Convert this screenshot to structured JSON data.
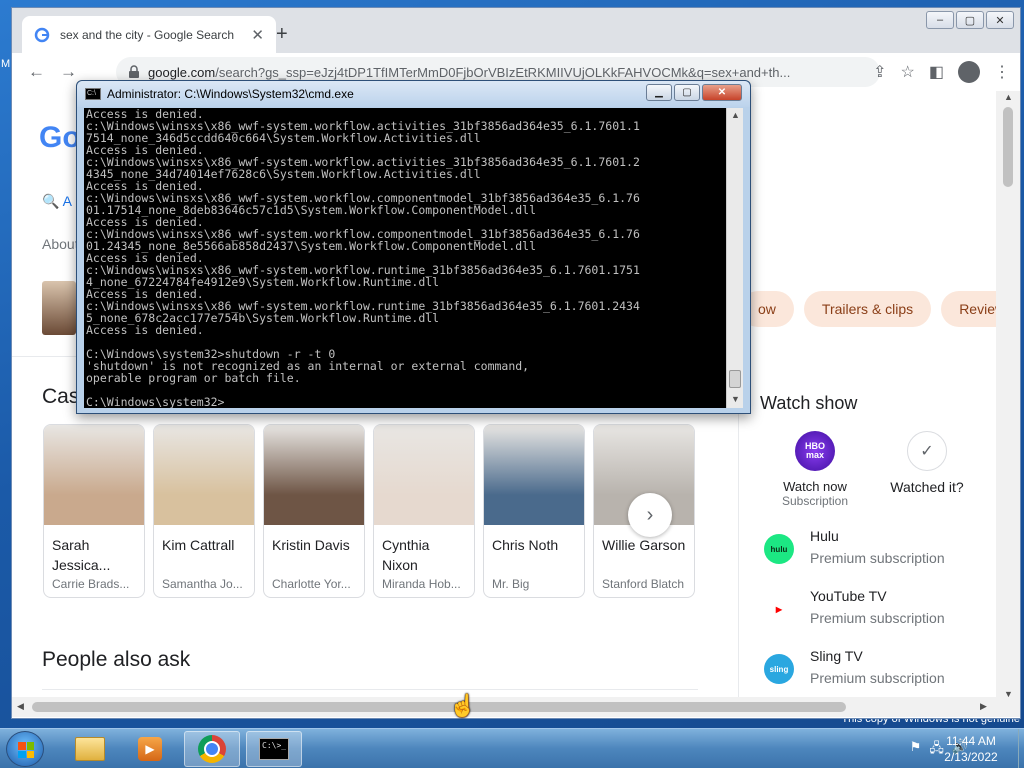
{
  "desktop": {
    "genuine_text": "This copy of Windows is not genuine",
    "side_fragments": [
      "M",
      "7",
      "1"
    ]
  },
  "browser": {
    "tab_title": "sex and the city - Google Search",
    "url_host": "google.com",
    "url_rest": "/search?gs_ssp=eJzj4tDP1TfIMTerMmD0FjbOrVBIzEtRKMIIVUjOLKkFAHVOCMk&q=sex+and+th...",
    "new_tab_glyph": "+",
    "window_controls": [
      "–",
      "▢",
      "✕"
    ]
  },
  "page": {
    "logo_fragment": "Go",
    "tab_fragment": "A",
    "about_fragment": "About",
    "chips": [
      "ow",
      "Trailers & clips",
      "Review"
    ],
    "cast_title_fragment": "Cas",
    "cast": [
      {
        "name": "Sarah Jessica...",
        "role": "Carrie Brads...",
        "color": "#c9a98d"
      },
      {
        "name": "Kim Cattrall",
        "role": "Samantha Jo...",
        "color": "#d8c19e"
      },
      {
        "name": "Kristin Davis",
        "role": "Charlotte Yor...",
        "color": "#6e5545"
      },
      {
        "name": "Cynthia Nixon",
        "role": "Miranda Hob...",
        "color": "#e6d9cf"
      },
      {
        "name": "Chris Noth",
        "role": "Mr. Big",
        "color": "#4a6a8c"
      },
      {
        "name": "Willie Garson",
        "role": "Stanford Blatch",
        "color": "#b8b3ad"
      }
    ],
    "people_also_ask": "People also ask",
    "watch_show": {
      "title": "Watch show",
      "hbo_logo": "HBO max",
      "watch_now": "Watch now",
      "watch_now_sub": "Subscription",
      "watched_it": "Watched it?",
      "providers": [
        {
          "name": "Hulu",
          "sub": "Premium subscription",
          "logo": "hulu",
          "color": "#1ce783",
          "text_color": "#0b2b17"
        },
        {
          "name": "YouTube TV",
          "sub": "Premium subscription",
          "logo": "▶",
          "color": "#ffffff",
          "text_color": "#ff0000"
        },
        {
          "name": "Sling TV",
          "sub": "Premium subscription",
          "logo": "sling",
          "color": "#2aa7e0",
          "text_color": "#ffffff"
        }
      ]
    }
  },
  "cmd": {
    "title": "Administrator: C:\\Windows\\System32\\cmd.exe",
    "icon_text": "C:\\",
    "lines": [
      "Access is denied.",
      "c:\\Windows\\winsxs\\x86_wwf-system.workflow.activities_31bf3856ad364e35_6.1.7601.1",
      "7514_none_346d5ccdd640c664\\System.Workflow.Activities.dll",
      "Access is denied.",
      "c:\\Windows\\winsxs\\x86_wwf-system.workflow.activities_31bf3856ad364e35_6.1.7601.2",
      "4345_none_34d74014ef7628c6\\System.Workflow.Activities.dll",
      "Access is denied.",
      "c:\\Windows\\winsxs\\x86_wwf-system.workflow.componentmodel_31bf3856ad364e35_6.1.76",
      "01.17514_none_8deb83646c57c1d5\\System.Workflow.ComponentModel.dll",
      "Access is denied.",
      "c:\\Windows\\winsxs\\x86_wwf-system.workflow.componentmodel_31bf3856ad364e35_6.1.76",
      "01.24345_none_8e5566ab858d2437\\System.Workflow.ComponentModel.dll",
      "Access is denied.",
      "c:\\Windows\\winsxs\\x86_wwf-system.workflow.runtime_31bf3856ad364e35_6.1.7601.1751",
      "4_none_67224784fe4912e9\\System.Workflow.Runtime.dll",
      "Access is denied.",
      "c:\\Windows\\winsxs\\x86_wwf-system.workflow.runtime_31bf3856ad364e35_6.1.7601.2434",
      "5_none_678c2acc177e754b\\System.Workflow.Runtime.dll",
      "Access is denied.",
      "",
      "C:\\Windows\\system32>shutdown -r -t 0",
      "'shutdown' is not recognized as an internal or external command,",
      "operable program or batch file.",
      "",
      "C:\\Windows\\system32>"
    ]
  },
  "taskbar": {
    "time": "11:44 AM",
    "date": "2/13/2022",
    "cmd_icon_text": "C:\\>_"
  }
}
